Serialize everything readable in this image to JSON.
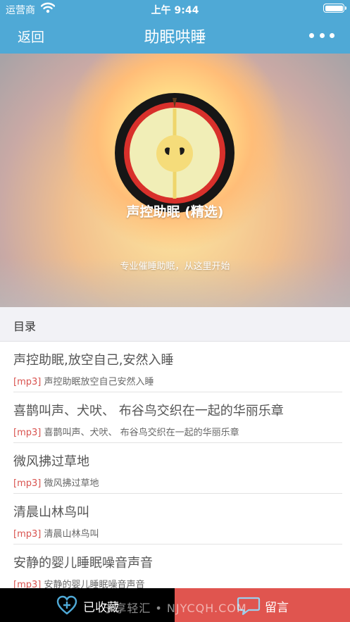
{
  "status_bar": {
    "carrier": "运营商",
    "time": "上午 9:44"
  },
  "nav": {
    "back_label": "返回",
    "title": "助眠哄睡",
    "more_icon": "more-dots-icon"
  },
  "album": {
    "title": "声控助眠 (精选)",
    "subtitle": "专业催睡助眠，从这里开始"
  },
  "section": {
    "title": "目录"
  },
  "tracks": [
    {
      "title": "声控助眠,放空自己,安然入睡",
      "tag": "[mp3]",
      "file": "声控助眠放空自己安然入睡"
    },
    {
      "title": "喜鹊叫声、犬吠、 布谷鸟交织在一起的华丽乐章",
      "tag": "[mp3]",
      "file": "喜鹊叫声、犬吠、 布谷鸟交织在一起的华丽乐章"
    },
    {
      "title": "微风拂过草地",
      "tag": "[mp3]",
      "file": "微风拂过草地"
    },
    {
      "title": "清晨山林鸟叫",
      "tag": "[mp3]",
      "file": "清晨山林鸟叫"
    },
    {
      "title": "安静的婴儿睡眠噪音声音",
      "tag": "[mp3]",
      "file": "安静的婴儿睡眠噪音声音"
    }
  ],
  "bottom_bar": {
    "favorite_label": "已收藏",
    "message_label": "留言"
  },
  "watermark": "宁享轻汇 • NJYCQH.COM",
  "colors": {
    "nav": "#4fa9d6",
    "tag": "#d9534f",
    "message_bg": "#e0554f",
    "favorite_bg": "#000000",
    "favorite_icon": "#4fa9d6"
  }
}
